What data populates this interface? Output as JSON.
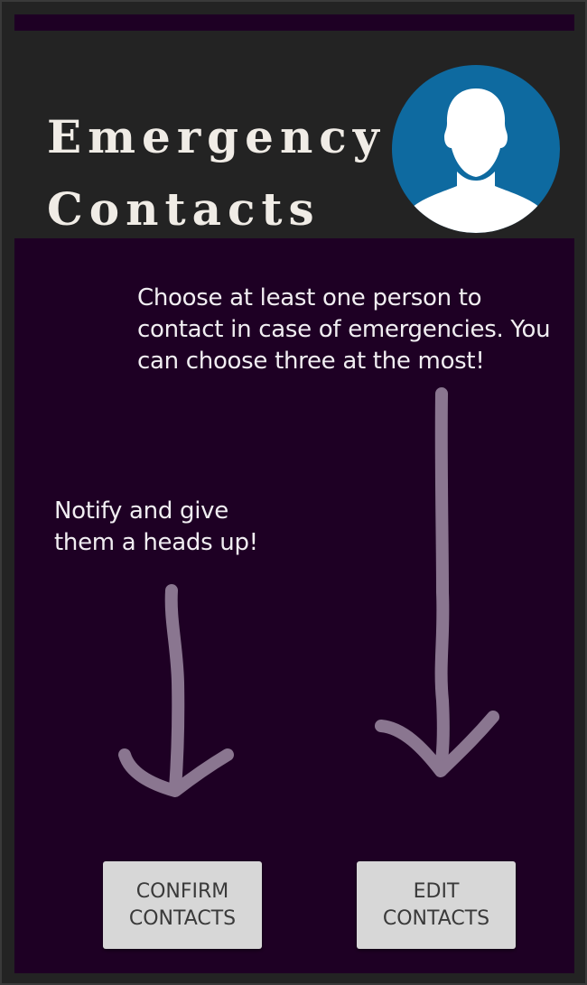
{
  "header": {
    "title": "Emergency\nContacts"
  },
  "instructions": {
    "edit_hint": "Choose at least one person to contact in case of emergencies. You can choose three at the most!",
    "confirm_hint": "Notify and give them a heads up!"
  },
  "buttons": {
    "confirm": {
      "line1": "CONFIRM",
      "line2": "CONTACTS"
    },
    "edit": {
      "line1": "EDIT",
      "line2": "CONTACTS"
    }
  },
  "colors": {
    "background": "#1e0024",
    "header": "#232323",
    "avatar_circle": "#0e6aa0",
    "arrow": "#8a7690",
    "button": "#d7d7d7"
  },
  "icons": {
    "avatar": "person-silhouette-icon",
    "confirm_arrow": "hand-drawn-down-arrow-icon",
    "edit_arrow": "hand-drawn-down-arrow-icon"
  }
}
